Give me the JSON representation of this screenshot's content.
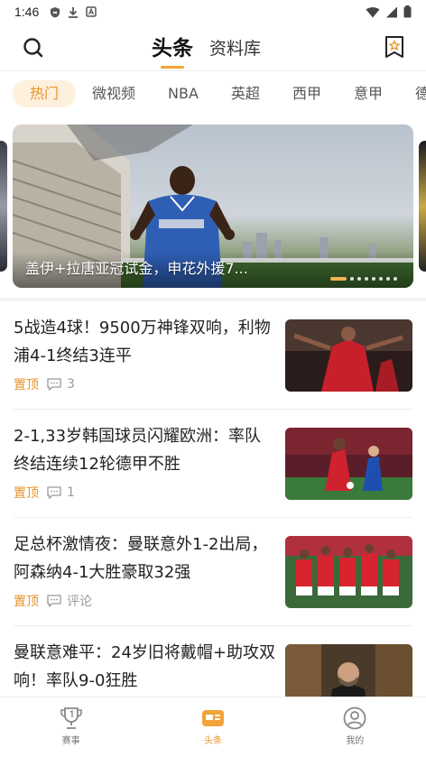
{
  "status_bar": {
    "time": "1:46"
  },
  "header": {
    "tabs": [
      {
        "label": "头条",
        "active": true
      },
      {
        "label": "资料库",
        "active": false
      }
    ]
  },
  "categories": [
    {
      "label": "热门",
      "active": true
    },
    {
      "label": "微视频"
    },
    {
      "label": "NBA"
    },
    {
      "label": "英超"
    },
    {
      "label": "西甲"
    },
    {
      "label": "意甲"
    },
    {
      "label": "德"
    }
  ],
  "banner": {
    "caption": "盖伊+拉唐亚冠试金，申花外援7...",
    "slide_count": 8,
    "active_slide": 1
  },
  "news": [
    {
      "title": "5战造4球！9500万神锋双响，利物浦4-1终结3连平",
      "tag": "置顶",
      "comments": "3"
    },
    {
      "title": "2-1,33岁韩国球员闪耀欧洲：率队终结连续12轮德甲不胜",
      "tag": "置顶",
      "comments": "1"
    },
    {
      "title": "足总杯激情夜：曼联意外1-2出局，阿森纳4-1大胜豪取32强",
      "tag": "置顶",
      "comments": "评论"
    },
    {
      "title": "曼联意难平：24岁旧将戴帽+助攻双响！率队9-0狂胜",
      "tag": "",
      "comments": ""
    }
  ],
  "bottom_nav": [
    {
      "label": "赛事",
      "icon": "trophy-icon",
      "active": false
    },
    {
      "label": "头条",
      "icon": "news-icon",
      "active": true
    },
    {
      "label": "我的",
      "icon": "profile-icon",
      "active": false
    }
  ],
  "colors": {
    "accent": "#e8922a",
    "accent_bg": "#fdf0dd",
    "dot_active": "#f3b356"
  }
}
